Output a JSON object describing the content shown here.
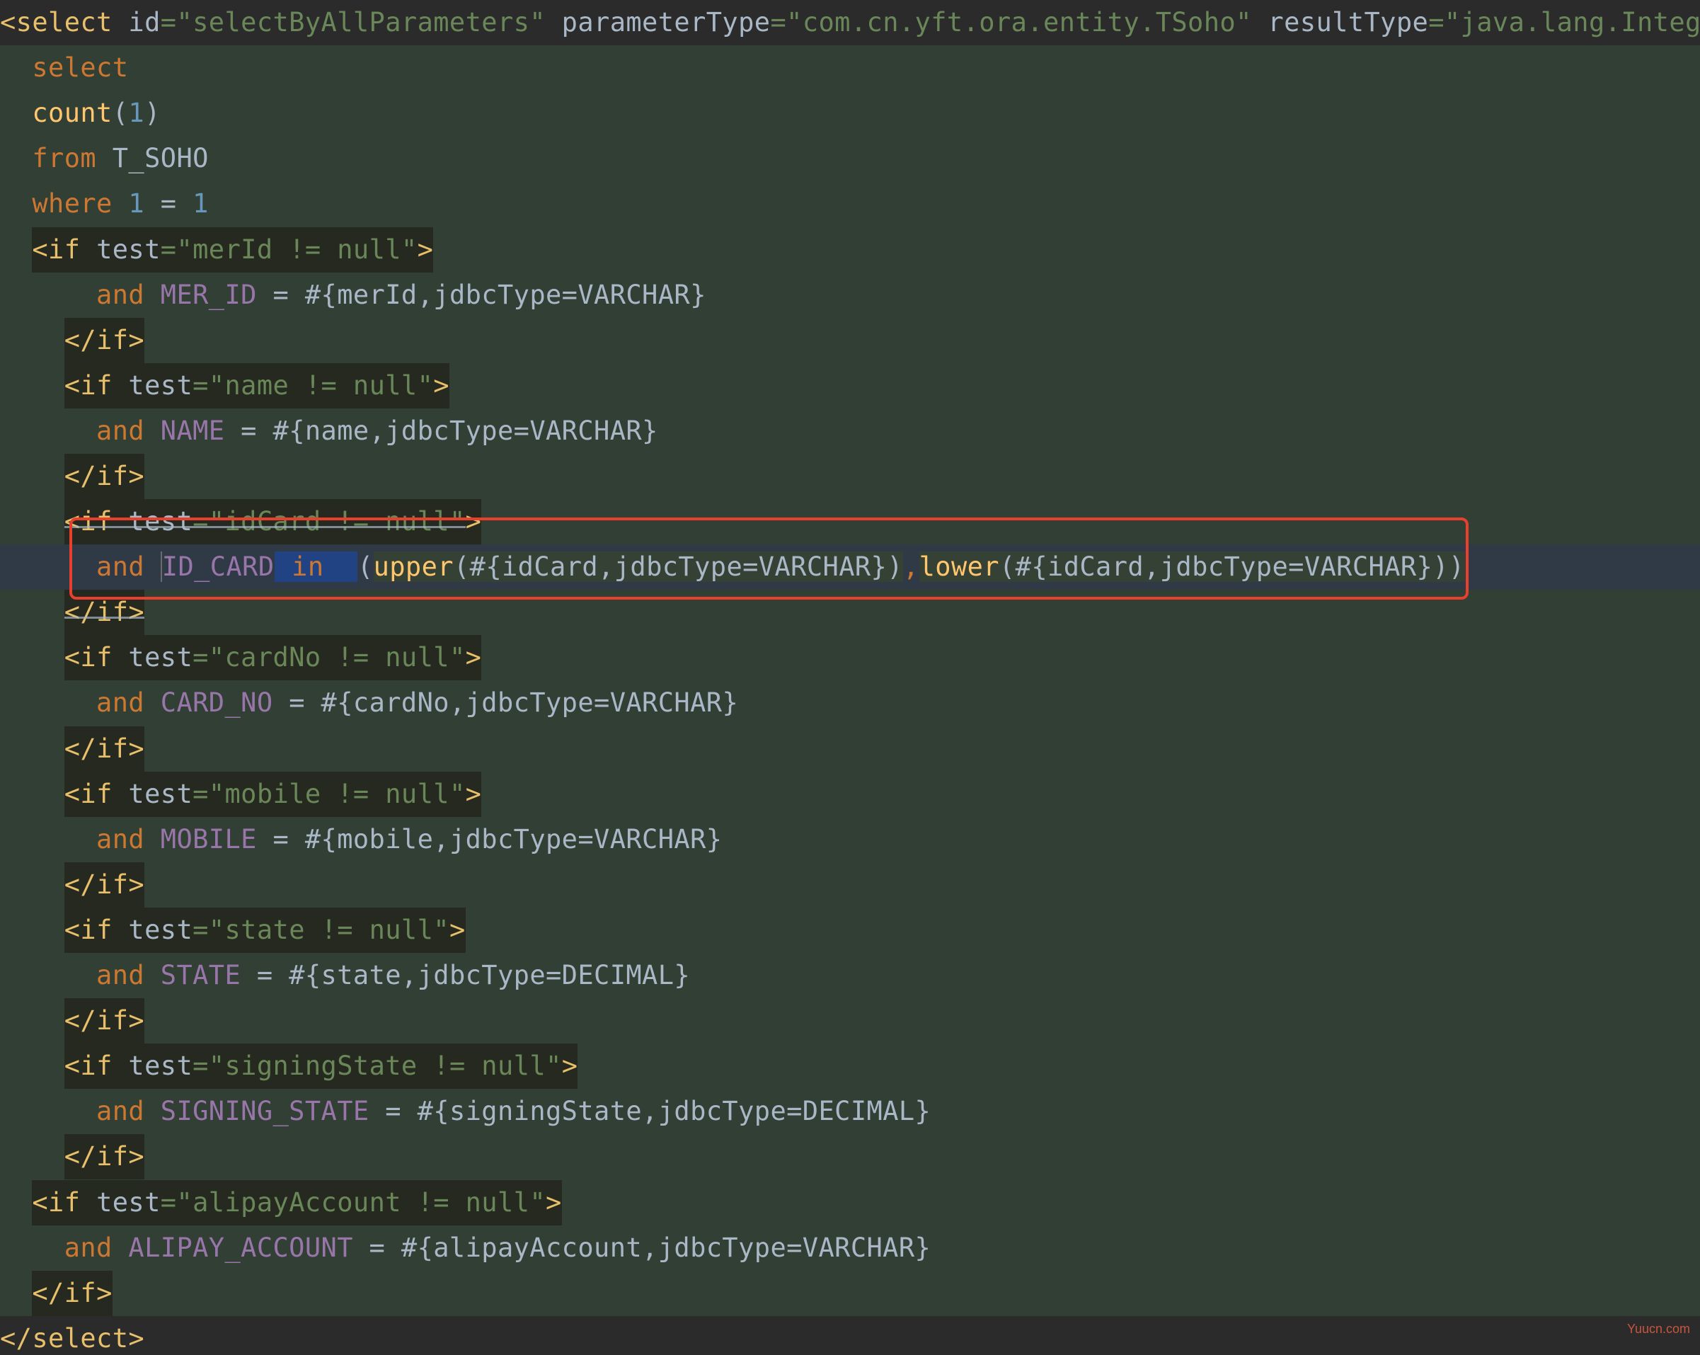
{
  "code_lines": [
    {
      "parts": [
        {
          "t": "<select",
          "c": "tag"
        },
        {
          "t": " id",
          "c": "txt"
        },
        {
          "t": "=\"selectByAllParameters\"",
          "c": "str"
        },
        {
          "t": " parameterType",
          "c": "txt"
        },
        {
          "t": "=\"com.cn.yft.ora.entity.TSoho\"",
          "c": "str"
        },
        {
          "t": " resultType",
          "c": "txt"
        },
        {
          "t": "=\"java.lang.Integer",
          "c": "str"
        }
      ]
    },
    {
      "parts": [
        {
          "t": "  select",
          "c": "kw"
        }
      ]
    },
    {
      "parts": [
        {
          "t": "  count",
          "c": "fn"
        },
        {
          "t": "(",
          "c": "txt"
        },
        {
          "t": "1",
          "c": "num"
        },
        {
          "t": ")",
          "c": "txt"
        }
      ]
    },
    {
      "parts": [
        {
          "t": "  from",
          "c": "kw"
        },
        {
          "t": " T_SOHO",
          "c": "txt"
        }
      ]
    },
    {
      "parts": [
        {
          "t": "  where",
          "c": "kw"
        },
        {
          "t": " 1",
          "c": "num"
        },
        {
          "t": " = ",
          "c": "txt"
        },
        {
          "t": "1",
          "c": "num"
        }
      ]
    },
    {
      "parts": [
        {
          "t": "  "
        },
        {
          "t": "<if",
          "c": "tag",
          "box": 1
        },
        {
          "t": " test",
          "c": "txt",
          "box": 1
        },
        {
          "t": "=\"merId != null\"",
          "c": "str",
          "box": 1
        },
        {
          "t": ">",
          "c": "tag",
          "box": 1
        }
      ]
    },
    {
      "parts": [
        {
          "t": "      and",
          "c": "kw"
        },
        {
          "t": " MER_ID",
          "c": "col"
        },
        {
          "t": " = #{merId,jdbcType=VARCHAR}",
          "c": "txt"
        }
      ]
    },
    {
      "parts": [
        {
          "t": "    "
        },
        {
          "t": "</if>",
          "c": "tag",
          "box": 1
        }
      ]
    },
    {
      "parts": [
        {
          "t": "    "
        },
        {
          "t": "<if",
          "c": "tag",
          "box": 1
        },
        {
          "t": " test",
          "c": "txt",
          "box": 1
        },
        {
          "t": "=\"name != null\"",
          "c": "str",
          "box": 1
        },
        {
          "t": ">",
          "c": "tag",
          "box": 1
        }
      ]
    },
    {
      "parts": [
        {
          "t": "      and",
          "c": "kw"
        },
        {
          "t": " NAME",
          "c": "col"
        },
        {
          "t": " = #{name,jdbcType=VARCHAR}",
          "c": "txt"
        }
      ]
    },
    {
      "parts": [
        {
          "t": "    "
        },
        {
          "t": "</if>",
          "c": "tag",
          "box": 1
        }
      ]
    },
    {
      "parts": [
        {
          "t": "    "
        },
        {
          "t": "<if",
          "c": "tag",
          "box": 1,
          "strike": 1
        },
        {
          "t": " test",
          "c": "txt",
          "box": 1,
          "strike": 1
        },
        {
          "t": "=\"idCard != null\"",
          "c": "str",
          "box": 1,
          "strike": 1
        },
        {
          "t": ">",
          "c": "tag",
          "box": 1
        }
      ]
    },
    {
      "parts": [
        {
          "t": "      and ",
          "c": "kw"
        },
        {
          "t": "ID_CARD",
          "c": "col",
          "caret": 1
        },
        {
          "t": " in  ",
          "c": "kw",
          "sel": 1
        },
        {
          "t": "(",
          "c": "txt"
        },
        {
          "t": "upper",
          "c": "fn",
          "hl": 1
        },
        {
          "t": "(#{idCard,jdbcType=VARCHAR})",
          "c": "txt",
          "hl": 1
        },
        {
          "t": ",",
          "c": "kw"
        },
        {
          "t": "lower",
          "c": "fn",
          "hl": 1
        },
        {
          "t": "(#{idCard,jdbcType=VARCHAR}))",
          "c": "txt",
          "hl": 1
        }
      ],
      "current": 1
    },
    {
      "parts": [
        {
          "t": "    "
        },
        {
          "t": "</if>",
          "c": "tag",
          "box": 1,
          "strike": 1
        }
      ]
    },
    {
      "parts": [
        {
          "t": "    "
        },
        {
          "t": "<if",
          "c": "tag",
          "box": 1
        },
        {
          "t": " test",
          "c": "txt",
          "box": 1
        },
        {
          "t": "=\"cardNo != null\"",
          "c": "str",
          "box": 1
        },
        {
          "t": ">",
          "c": "tag",
          "box": 1
        }
      ]
    },
    {
      "parts": [
        {
          "t": "      and",
          "c": "kw"
        },
        {
          "t": " CARD_NO",
          "c": "col"
        },
        {
          "t": " = #{cardNo,jdbcType=VARCHAR}",
          "c": "txt"
        }
      ]
    },
    {
      "parts": [
        {
          "t": "    "
        },
        {
          "t": "</if>",
          "c": "tag",
          "box": 1
        }
      ]
    },
    {
      "parts": [
        {
          "t": "    "
        },
        {
          "t": "<if",
          "c": "tag",
          "box": 1
        },
        {
          "t": " test",
          "c": "txt",
          "box": 1
        },
        {
          "t": "=\"mobile != null\"",
          "c": "str",
          "box": 1
        },
        {
          "t": ">",
          "c": "tag",
          "box": 1
        }
      ]
    },
    {
      "parts": [
        {
          "t": "      and",
          "c": "kw"
        },
        {
          "t": " MOBILE",
          "c": "col"
        },
        {
          "t": " = #{mobile,jdbcType=VARCHAR}",
          "c": "txt"
        }
      ]
    },
    {
      "parts": [
        {
          "t": "    "
        },
        {
          "t": "</if>",
          "c": "tag",
          "box": 1
        }
      ]
    },
    {
      "parts": [
        {
          "t": "    "
        },
        {
          "t": "<if",
          "c": "tag",
          "box": 1
        },
        {
          "t": " test",
          "c": "txt",
          "box": 1
        },
        {
          "t": "=\"state != null\"",
          "c": "str",
          "box": 1
        },
        {
          "t": ">",
          "c": "tag",
          "box": 1
        }
      ]
    },
    {
      "parts": [
        {
          "t": "      and",
          "c": "kw"
        },
        {
          "t": " STATE",
          "c": "col"
        },
        {
          "t": " = #{state,jdbcType=DECIMAL}",
          "c": "txt"
        }
      ]
    },
    {
      "parts": [
        {
          "t": "    "
        },
        {
          "t": "</if>",
          "c": "tag",
          "box": 1
        }
      ]
    },
    {
      "parts": [
        {
          "t": "    "
        },
        {
          "t": "<if",
          "c": "tag",
          "box": 1
        },
        {
          "t": " test",
          "c": "txt",
          "box": 1
        },
        {
          "t": "=\"signingState != null\"",
          "c": "str",
          "box": 1
        },
        {
          "t": ">",
          "c": "tag",
          "box": 1
        }
      ]
    },
    {
      "parts": [
        {
          "t": "      and",
          "c": "kw"
        },
        {
          "t": " SIGNING_STATE",
          "c": "col"
        },
        {
          "t": " = #{signingState,jdbcType=DECIMAL}",
          "c": "txt"
        }
      ]
    },
    {
      "parts": [
        {
          "t": "    "
        },
        {
          "t": "</if>",
          "c": "tag",
          "box": 1
        }
      ]
    },
    {
      "parts": [
        {
          "t": "  "
        },
        {
          "t": "<if",
          "c": "tag",
          "box": 1
        },
        {
          "t": " test",
          "c": "txt",
          "box": 1
        },
        {
          "t": "=\"alipayAccount != null\"",
          "c": "str",
          "box": 1
        },
        {
          "t": ">",
          "c": "tag",
          "box": 1
        }
      ]
    },
    {
      "parts": [
        {
          "t": "    and",
          "c": "kw"
        },
        {
          "t": " ALIPAY_ACCOUNT",
          "c": "col"
        },
        {
          "t": " = #{alipayAccount,jdbcType=VARCHAR}",
          "c": "txt"
        }
      ]
    },
    {
      "parts": [
        {
          "t": "  "
        },
        {
          "t": "</if>",
          "c": "tag",
          "box": 1
        }
      ]
    },
    {
      "parts": [
        {
          "t": "</select>",
          "c": "tag"
        }
      ]
    }
  ],
  "watermark": "Yuucn.com",
  "colors": {
    "background": "#323f34",
    "keyword": "#cc7832",
    "function": "#ffc66d",
    "number": "#6897bb",
    "column": "#9876aa",
    "string": "#6a8759",
    "tag": "#e8bf6a",
    "highlight_box": "#e8402d"
  }
}
